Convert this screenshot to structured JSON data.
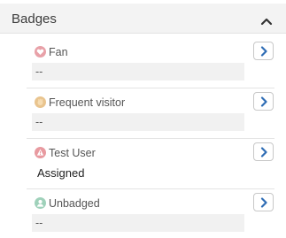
{
  "panel": {
    "title": "Badges",
    "collapse_icon": "chevron-up-icon"
  },
  "badges": [
    {
      "label": "Fan",
      "value": "--",
      "icon": "heart-icon",
      "icon_color": "#e8a1a8",
      "button_icon": "chevron-right-icon"
    },
    {
      "label": "Frequent visitor",
      "value": "--",
      "icon": "hand-icon",
      "icon_color": "#e9c48e",
      "button_icon": "chevron-right-icon"
    },
    {
      "label": "Test User",
      "value": "Assigned",
      "icon": "warning-icon",
      "icon_color": "#e89aa0",
      "button_icon": "chevron-right-icon"
    },
    {
      "label": "Unbadged",
      "value": "--",
      "icon": "user-icon",
      "icon_color": "#9fd1ba",
      "button_icon": "chevron-right-icon"
    }
  ],
  "colors": {
    "accent": "#2f6db5",
    "header_bg": "#f3f3f3"
  }
}
